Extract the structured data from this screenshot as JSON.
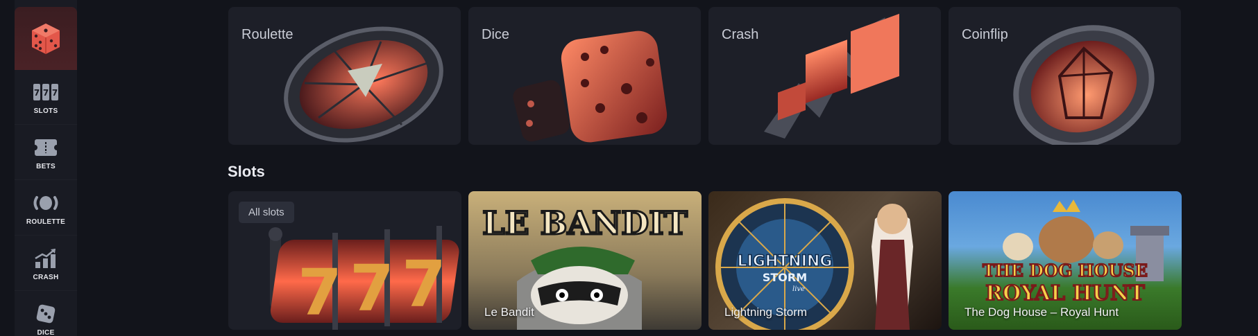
{
  "sidebar": {
    "logo_icon": "dice-logo-icon",
    "items": [
      {
        "label": "SLOTS",
        "icon": "slot-reels-icon"
      },
      {
        "label": "BETS",
        "icon": "ticket-icon"
      },
      {
        "label": "ROULETTE",
        "icon": "roulette-icon"
      },
      {
        "label": "CRASH",
        "icon": "crash-chart-icon"
      },
      {
        "label": "DICE",
        "icon": "dice-icon"
      }
    ]
  },
  "games": [
    {
      "title": "Roulette"
    },
    {
      "title": "Dice"
    },
    {
      "title": "Crash"
    },
    {
      "title": "Coinflip"
    }
  ],
  "slots": {
    "heading": "Slots",
    "all_slots_label": "All slots",
    "tiles": [
      {
        "caption": "Le Bandit",
        "art_text": "LE BANDIT"
      },
      {
        "caption": "Lightning Storm",
        "art_text": "LIGHTNING",
        "art_text2": "STORM",
        "art_text3": "live"
      },
      {
        "caption": "The Dog House – Royal Hunt",
        "art_text": "THE DOG HOUSE",
        "art_text2": "ROYAL HUNT"
      }
    ]
  },
  "colors": {
    "background": "#12141b",
    "sidebar": "#191b23",
    "card": "#1d1f28",
    "accent": "#e8503a"
  }
}
